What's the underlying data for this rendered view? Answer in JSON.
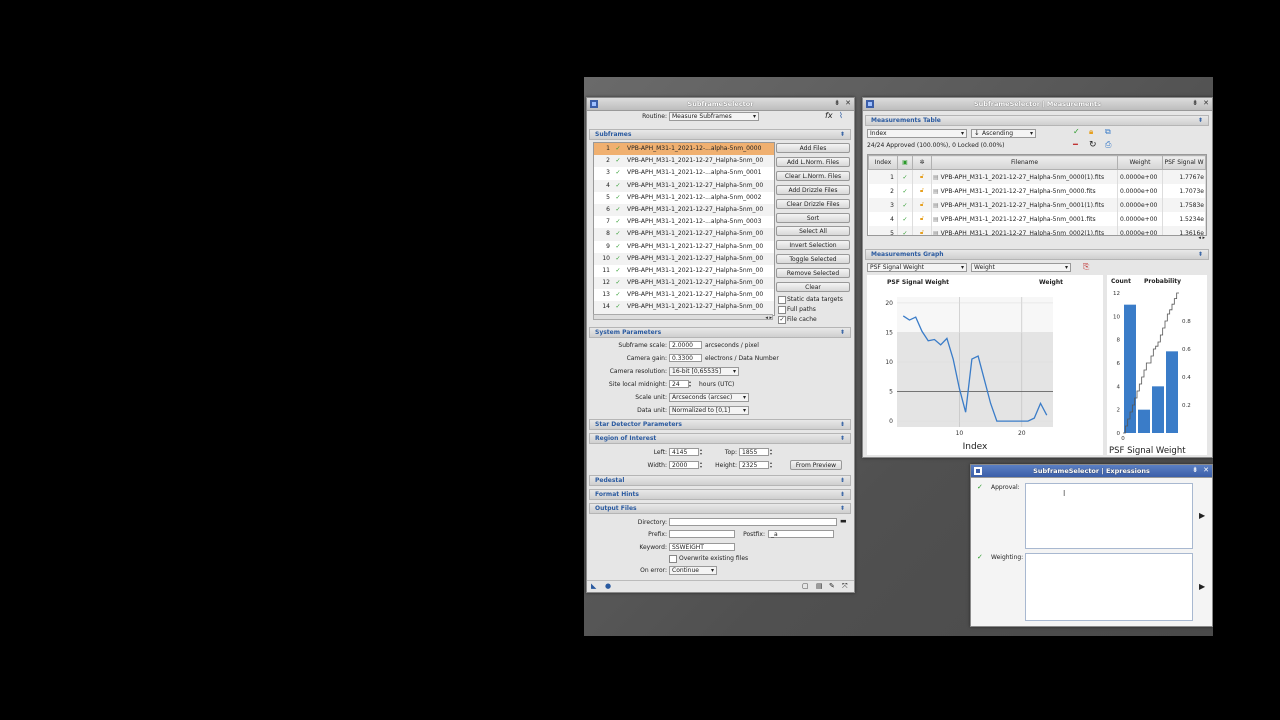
{
  "main": {
    "title": "SubframeSelector",
    "routine_label": "Routine:",
    "routine_value": "Measure Subframes",
    "subframes_header": "Subframes",
    "files": [
      {
        "idx": "1",
        "name": "VPB-APH_M31-1_2021-12-...alpha-5nm_0000"
      },
      {
        "idx": "2",
        "name": "VPB-APH_M31-1_2021-12-27_Halpha-5nm_00"
      },
      {
        "idx": "3",
        "name": "VPB-APH_M31-1_2021-12-...alpha-5nm_0001"
      },
      {
        "idx": "4",
        "name": "VPB-APH_M31-1_2021-12-27_Halpha-5nm_00"
      },
      {
        "idx": "5",
        "name": "VPB-APH_M31-1_2021-12-...alpha-5nm_0002"
      },
      {
        "idx": "6",
        "name": "VPB-APH_M31-1_2021-12-27_Halpha-5nm_00"
      },
      {
        "idx": "7",
        "name": "VPB-APH_M31-1_2021-12-...alpha-5nm_0003"
      },
      {
        "idx": "8",
        "name": "VPB-APH_M31-1_2021-12-27_Halpha-5nm_00"
      },
      {
        "idx": "9",
        "name": "VPB-APH_M31-1_2021-12-27_Halpha-5nm_00"
      },
      {
        "idx": "10",
        "name": "VPB-APH_M31-1_2021-12-27_Halpha-5nm_00"
      },
      {
        "idx": "11",
        "name": "VPB-APH_M31-1_2021-12-27_Halpha-5nm_00"
      },
      {
        "idx": "12",
        "name": "VPB-APH_M31-1_2021-12-27_Halpha-5nm_00"
      },
      {
        "idx": "13",
        "name": "VPB-APH_M31-1_2021-12-27_Halpha-5nm_00"
      },
      {
        "idx": "14",
        "name": "VPB-APH_M31-1_2021-12-27_Halpha-5nm_00"
      }
    ],
    "buttons": [
      "Add Files",
      "Add L.Norm. Files",
      "Clear L.Norm. Files",
      "Add Drizzle Files",
      "Clear Drizzle Files",
      "Sort",
      "Select All",
      "Invert Selection",
      "Toggle Selected",
      "Remove Selected",
      "Clear"
    ],
    "checks": [
      "Static data targets",
      "Full paths",
      "File cache"
    ],
    "system_header": "System Parameters",
    "subframe_scale_label": "Subframe scale:",
    "subframe_scale_value": "2.0000",
    "subframe_scale_unit": "arcseconds / pixel",
    "camera_gain_label": "Camera gain:",
    "camera_gain_value": "0.3300",
    "camera_gain_unit": "electrons / Data Number",
    "camera_res_label": "Camera resolution:",
    "camera_res_value": "16-bit [0,65535]",
    "midnight_label": "Site local midnight:",
    "midnight_value": "24",
    "midnight_unit": "hours (UTC)",
    "scale_unit_label": "Scale unit:",
    "scale_unit_value": "Arcseconds (arcsec)",
    "data_unit_label": "Data unit:",
    "data_unit_value": "Normalized to [0,1]",
    "star_header": "Star Detector Parameters",
    "roi_header": "Region of Interest",
    "left_label": "Left:",
    "left_value": "4145",
    "top_label": "Top:",
    "top_value": "1855",
    "width_label": "Width:",
    "width_value": "2000",
    "height_label": "Height:",
    "height_value": "2325",
    "from_preview": "From Preview",
    "pedestal_header": "Pedestal",
    "format_header": "Format Hints",
    "output_header": "Output Files",
    "directory_label": "Directory:",
    "directory_value": "",
    "prefix_label": "Prefix:",
    "prefix_value": "",
    "postfix_label": "Postfix:",
    "postfix_value": "_a",
    "keyword_label": "Keyword:",
    "keyword_value": "SSWEIGHT",
    "overwrite_label": "Overwrite existing files",
    "onerror_label": "On error:",
    "onerror_value": "Continue"
  },
  "meas": {
    "title": "SubframeSelector | Measurements",
    "table_header": "Measurements Table",
    "sort_field": "Index",
    "sort_order": "Ascending",
    "summary": "24/24 Approved (100.00%), 0 Locked (0.00%)",
    "cols": [
      "Index",
      "",
      "",
      "Filename",
      "Weight",
      "PSF Signal W"
    ],
    "rows": [
      {
        "i": "1",
        "f": "VPB-APH_M31-1_2021-12-27_Halpha-5nm_0000(1).fits",
        "w": "0.0000e+00",
        "p": "1.7767e"
      },
      {
        "i": "2",
        "f": "VPB-APH_M31-1_2021-12-27_Halpha-5nm_0000.fits",
        "w": "0.0000e+00",
        "p": "1.7073e"
      },
      {
        "i": "3",
        "f": "VPB-APH_M31-1_2021-12-27_Halpha-5nm_0001(1).fits",
        "w": "0.0000e+00",
        "p": "1.7583e"
      },
      {
        "i": "4",
        "f": "VPB-APH_M31-1_2021-12-27_Halpha-5nm_0001.fits",
        "w": "0.0000e+00",
        "p": "1.5234e"
      },
      {
        "i": "5",
        "f": "VPB-APH_M31-1_2021-12-27_Halpha-5nm_0002(1).fits",
        "w": "0.0000e+00",
        "p": "1.3616e"
      }
    ],
    "graph_header": "Measurements Graph",
    "graph_x": "PSF Signal Weight",
    "graph_y": "Weight"
  },
  "expr": {
    "title": "SubframeSelector | Expressions",
    "approval_label": "Approval:",
    "weighting_label": "Weighting:"
  },
  "chart_data": [
    {
      "type": "line",
      "title": "PSF Signal Weight",
      "title_right": "Weight",
      "xlabel": "Index",
      "x_ticks": [
        10,
        20
      ],
      "y_ticks": [
        0,
        5,
        10,
        15,
        20
      ],
      "xlim": [
        0,
        25
      ],
      "ylim": [
        -1,
        21
      ],
      "x": [
        1,
        2,
        3,
        4,
        5,
        6,
        7,
        8,
        9,
        10,
        11,
        12,
        13,
        14,
        15,
        16,
        17,
        18,
        19,
        20,
        21,
        22,
        23,
        24
      ],
      "values": [
        17.8,
        17.1,
        17.6,
        15.2,
        13.6,
        13.8,
        12.9,
        14.0,
        10.5,
        5.5,
        1.5,
        10.5,
        11.0,
        7.0,
        3.0,
        0.0,
        0.0,
        0.0,
        0.0,
        0.0,
        0.0,
        0.5,
        3.0,
        1.0
      ],
      "line_color": "#3a7cc8"
    },
    {
      "type": "bar",
      "xlabel": "PSF Signal Weight",
      "ylabel_left": "Count",
      "ylabel_right": "Probability",
      "y_ticks": [
        0,
        2,
        4,
        6,
        8,
        10,
        12
      ],
      "y2_ticks": [
        0.2,
        0.4,
        0.6,
        0.8
      ],
      "x_ticks": [
        0
      ],
      "values": [
        11,
        2,
        4,
        7
      ],
      "cdf": [
        0.0,
        0.05,
        0.1,
        0.15,
        0.2,
        0.25,
        0.3,
        0.35,
        0.4,
        0.45,
        0.5,
        0.5,
        0.55,
        0.6,
        0.62,
        0.65,
        0.7,
        0.75,
        0.8,
        0.85,
        0.88,
        0.92,
        0.96,
        1.0
      ],
      "bar_color": "#3a7cc8"
    }
  ]
}
